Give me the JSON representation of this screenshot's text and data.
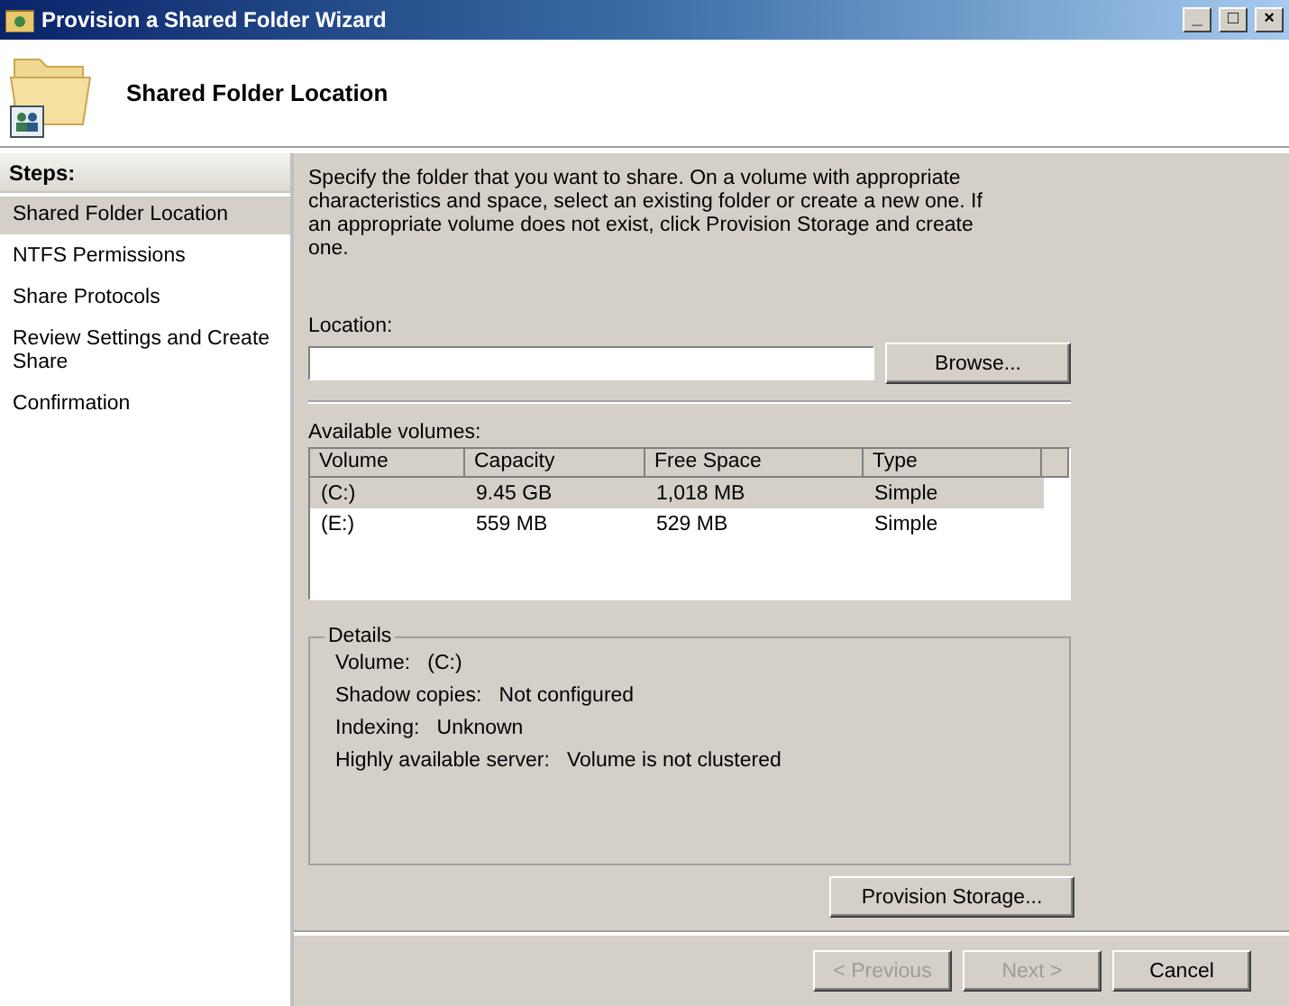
{
  "window": {
    "title": "Provision a Shared Folder Wizard",
    "controls": [
      "_",
      "□",
      "×"
    ]
  },
  "header": {
    "title": "Shared Folder Location"
  },
  "sidebar": {
    "heading": "Steps:",
    "items": [
      {
        "label": "Shared Folder Location",
        "selected": true
      },
      {
        "label": "NTFS Permissions",
        "selected": false
      },
      {
        "label": "Share Protocols",
        "selected": false
      },
      {
        "label": "Review Settings and Create Share",
        "selected": false
      },
      {
        "label": "Confirmation",
        "selected": false
      }
    ]
  },
  "intro": "Specify the folder that you want to share. On a volume with appropriate characteristics and space, select an existing folder or create a new one. If an appropriate volume does not exist, click Provision Storage and create one.",
  "location": {
    "label": "Location:",
    "browse_button": "Browse..."
  },
  "volumes": {
    "label": "Available volumes:",
    "columns": [
      "Volume",
      "Capacity",
      "Free Space",
      "Type"
    ],
    "rows": [
      {
        "cells": [
          "(C:)",
          "9.45 GB",
          "1,018 MB",
          "Simple"
        ],
        "selected": true
      },
      {
        "cells": [
          "(E:)",
          "559 MB",
          "529 MB",
          "Simple"
        ],
        "selected": false
      }
    ]
  },
  "details": {
    "title": "Details",
    "fields": [
      {
        "label": "Volume:",
        "value": "(C:)"
      },
      {
        "label": "Shadow copies:",
        "value": "Not configured"
      },
      {
        "label": "Indexing:",
        "value": "Unknown"
      },
      {
        "label": "Highly available server:",
        "value": "Volume is not clustered"
      }
    ]
  },
  "provision_button": "Provision Storage...",
  "buttons": [
    {
      "label": "< Previous",
      "disabled": true
    },
    {
      "label": "Next >",
      "disabled": true
    },
    {
      "label": "Cancel",
      "disabled": false
    }
  ]
}
